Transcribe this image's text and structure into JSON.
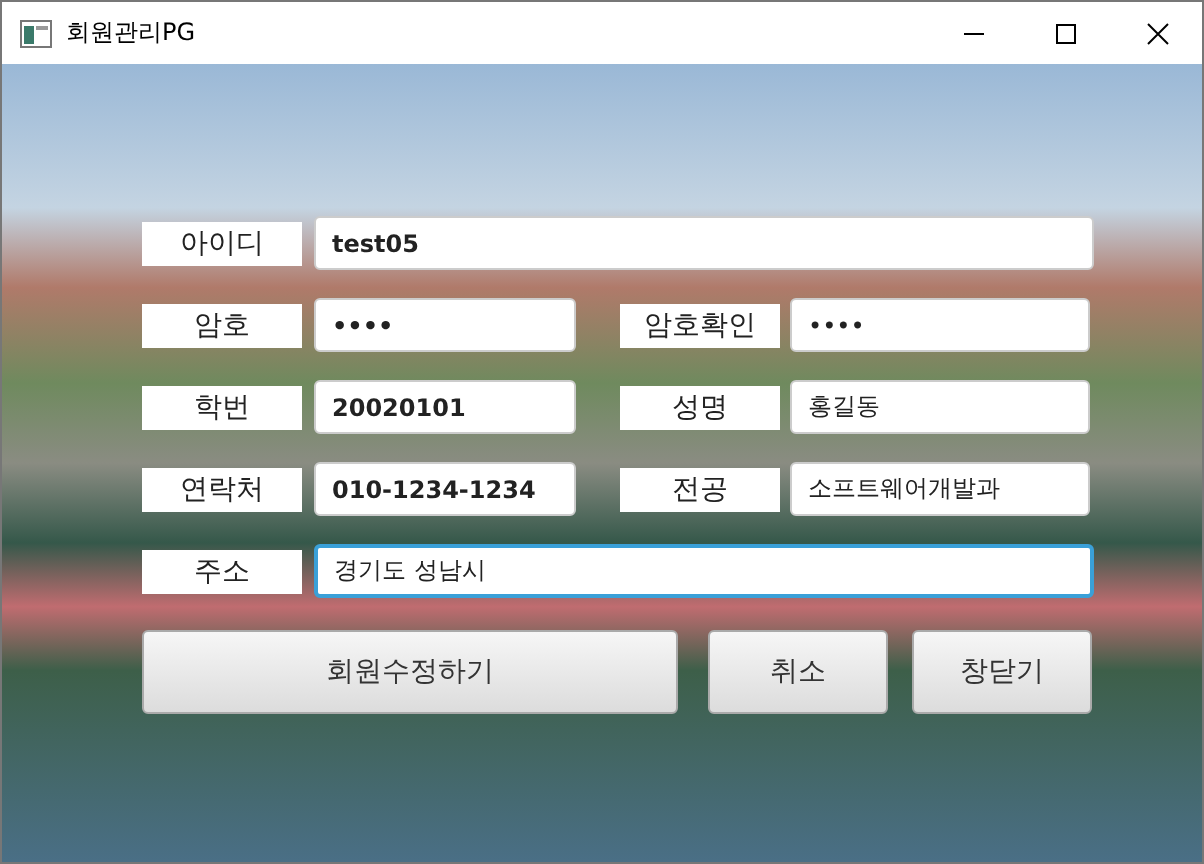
{
  "window": {
    "title": "회원관리PG"
  },
  "rows": [
    [
      {
        "label": "아이디",
        "value": "test05",
        "focused": false
      }
    ],
    [
      {
        "label": "암호",
        "value": "••••",
        "focused": false
      },
      {
        "label": "암호확인",
        "value": "••••",
        "focused": false
      }
    ],
    [
      {
        "label": "학번",
        "value": "20020101",
        "focused": false
      },
      {
        "label": "성명",
        "value": "홍길동",
        "focused": false
      }
    ],
    [
      {
        "label": "연락처",
        "value": "010-1234-1234",
        "focused": false
      },
      {
        "label": "전공",
        "value": "소프트웨어개발과",
        "focused": false
      }
    ],
    [
      {
        "label": "주소",
        "value": "경기도 성남시",
        "focused": true
      }
    ]
  ],
  "buttons": [
    {
      "label": "회원수정하기",
      "kind": "wide"
    },
    {
      "label": "취소",
      "kind": "normal"
    },
    {
      "label": "창닫기",
      "kind": "normal"
    }
  ]
}
